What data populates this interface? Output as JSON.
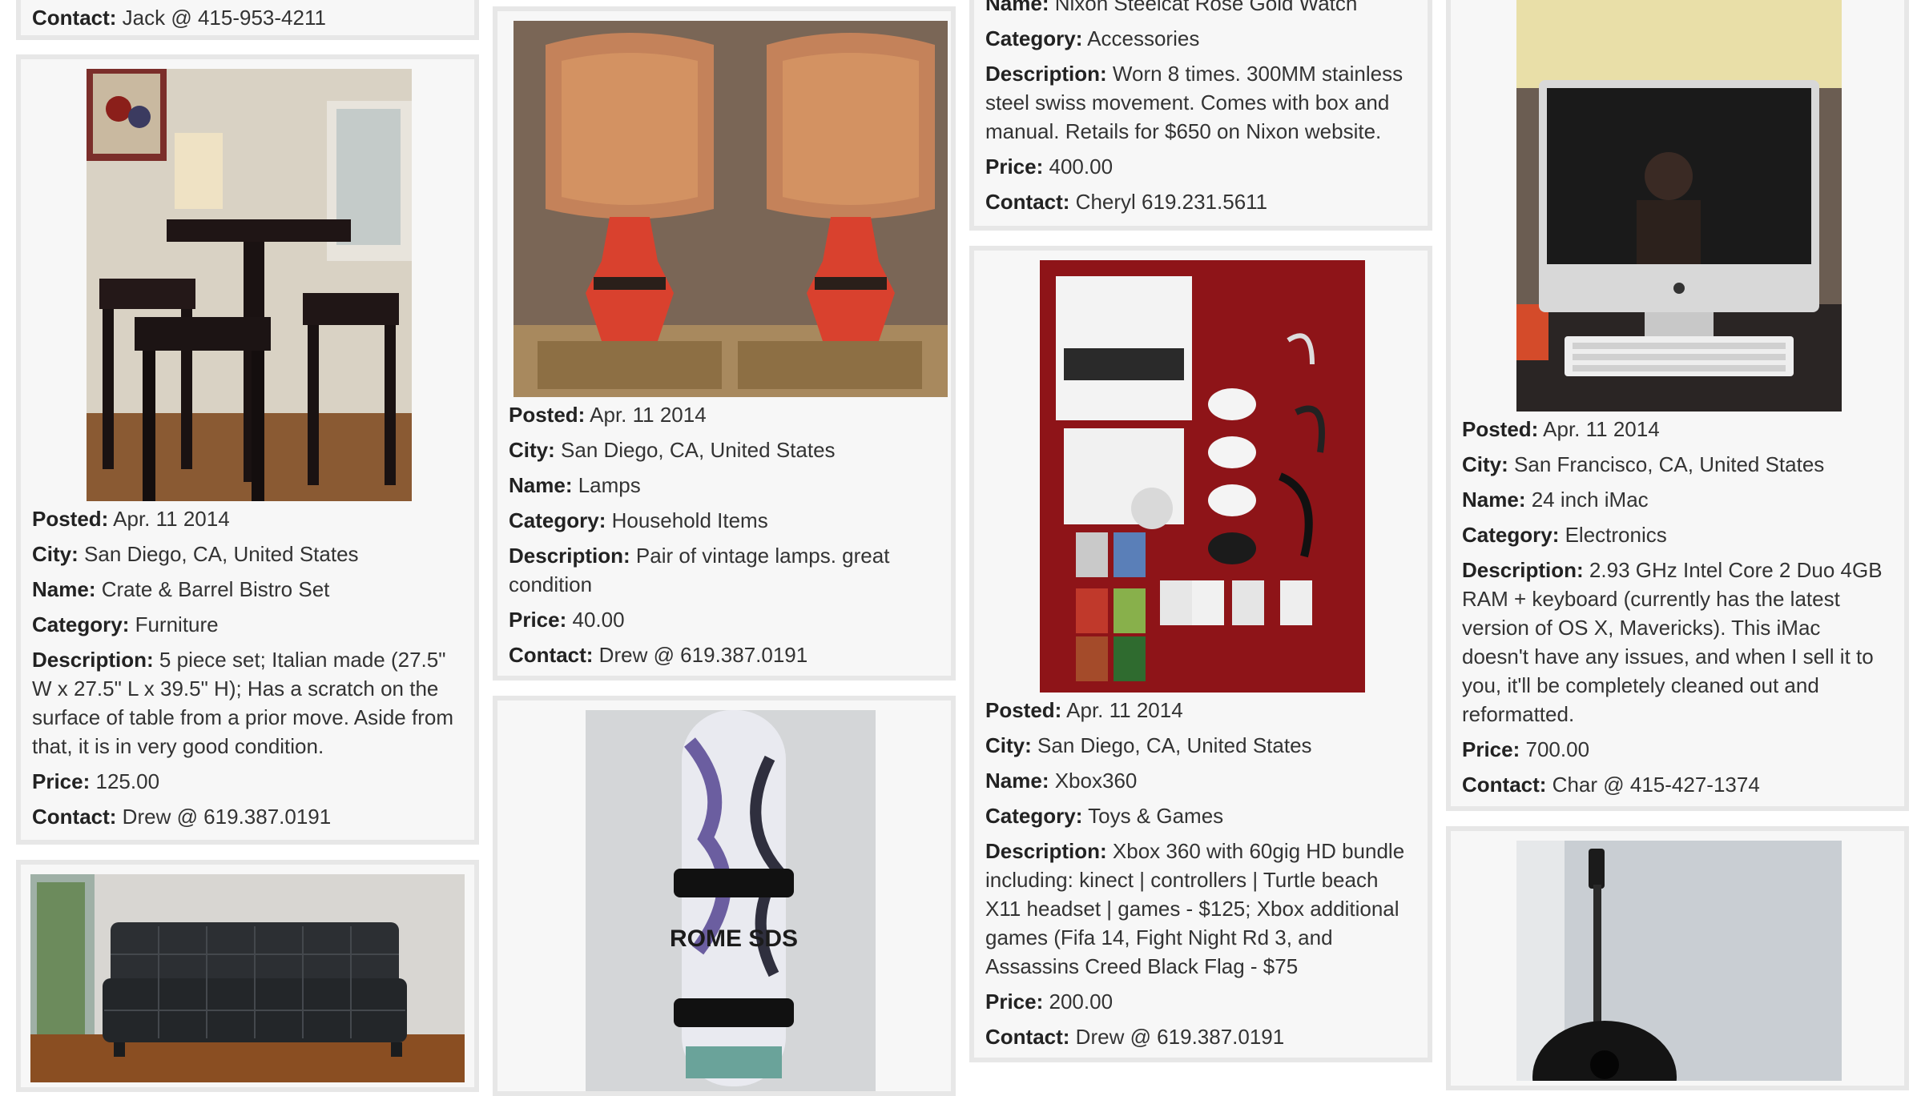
{
  "listings": {
    "jack_partial": {
      "contact_label": "Contact:",
      "contact": "Jack @ 415-953-4211"
    },
    "bistro": {
      "image_alt": "bistro set photo",
      "posted_label": "Posted:",
      "posted": "Apr. 11 2014",
      "city_label": "City:",
      "city": "San Diego, CA, United States",
      "name_label": "Name:",
      "name": "Crate & Barrel Bistro Set",
      "category_label": "Category:",
      "category": "Furniture",
      "description_label": "Description:",
      "description": "5 piece set; Italian made (27.5\" W x 27.5\" L x 39.5\" H); Has a scratch on the surface of table from a prior move. Aside from that, it is in very good condition.",
      "price_label": "Price:",
      "price": "125.00",
      "contact_label": "Contact:",
      "contact": "Drew @ 619.387.0191"
    },
    "sofa": {
      "image_alt": "sofa photo"
    },
    "lamps": {
      "image_alt": "lamps photo",
      "posted_label": "Posted:",
      "posted": "Apr. 11 2014",
      "city_label": "City:",
      "city": "San Diego, CA, United States",
      "name_label": "Name:",
      "name": "Lamps",
      "category_label": "Category:",
      "category": "Household Items",
      "description_label": "Description:",
      "description": "Pair of vintage lamps. great condition",
      "price_label": "Price:",
      "price": "40.00",
      "contact_label": "Contact:",
      "contact": "Drew @ 619.387.0191"
    },
    "snowboard": {
      "image_alt": "snowboard photo",
      "board_text": "ROME SDS"
    },
    "watch": {
      "name_label": "Name:",
      "name": "Nixon Steelcat Rose Gold Watch",
      "category_label": "Category:",
      "category": "Accessories",
      "description_label": "Description:",
      "description": "Worn 8 times. 300MM stainless steel swiss movement. Comes with box and manual. Retails for $650 on Nixon website.",
      "price_label": "Price:",
      "price": "400.00",
      "contact_label": "Contact:",
      "contact": "Cheryl 619.231.5611"
    },
    "xbox": {
      "image_alt": "xbox bundle photo",
      "posted_label": "Posted:",
      "posted": "Apr. 11 2014",
      "city_label": "City:",
      "city": "San Diego, CA, United States",
      "name_label": "Name:",
      "name": "Xbox360",
      "category_label": "Category:",
      "category": "Toys & Games",
      "description_label": "Description:",
      "description": "Xbox 360 with 60gig HD bundle including: kinect | controllers | Turtle beach X11 headset | games - $125; Xbox additional games (Fifa 14, Fight Night Rd 3, and Assassins Creed Black Flag - $75",
      "price_label": "Price:",
      "price": "200.00",
      "contact_label": "Contact:",
      "contact": "Drew @ 619.387.0191"
    },
    "imac": {
      "image_alt": "iMac photo",
      "posted_label": "Posted:",
      "posted": "Apr. 11 2014",
      "city_label": "City:",
      "city": "San Francisco, CA, United States",
      "name_label": "Name:",
      "name": "24 inch iMac",
      "category_label": "Category:",
      "category": "Electronics",
      "description_label": "Description:",
      "description": "2.93 GHz Intel Core 2 Duo 4GB RAM + keyboard (currently has the latest version of OS X, Mavericks). This iMac doesn't have any issues, and when I sell it to you, it'll be completely cleaned out and reformatted.",
      "price_label": "Price:",
      "price": "700.00",
      "contact_label": "Contact:",
      "contact": "Char @ 415-427-1374"
    },
    "guitar": {
      "image_alt": "guitar photo"
    }
  }
}
